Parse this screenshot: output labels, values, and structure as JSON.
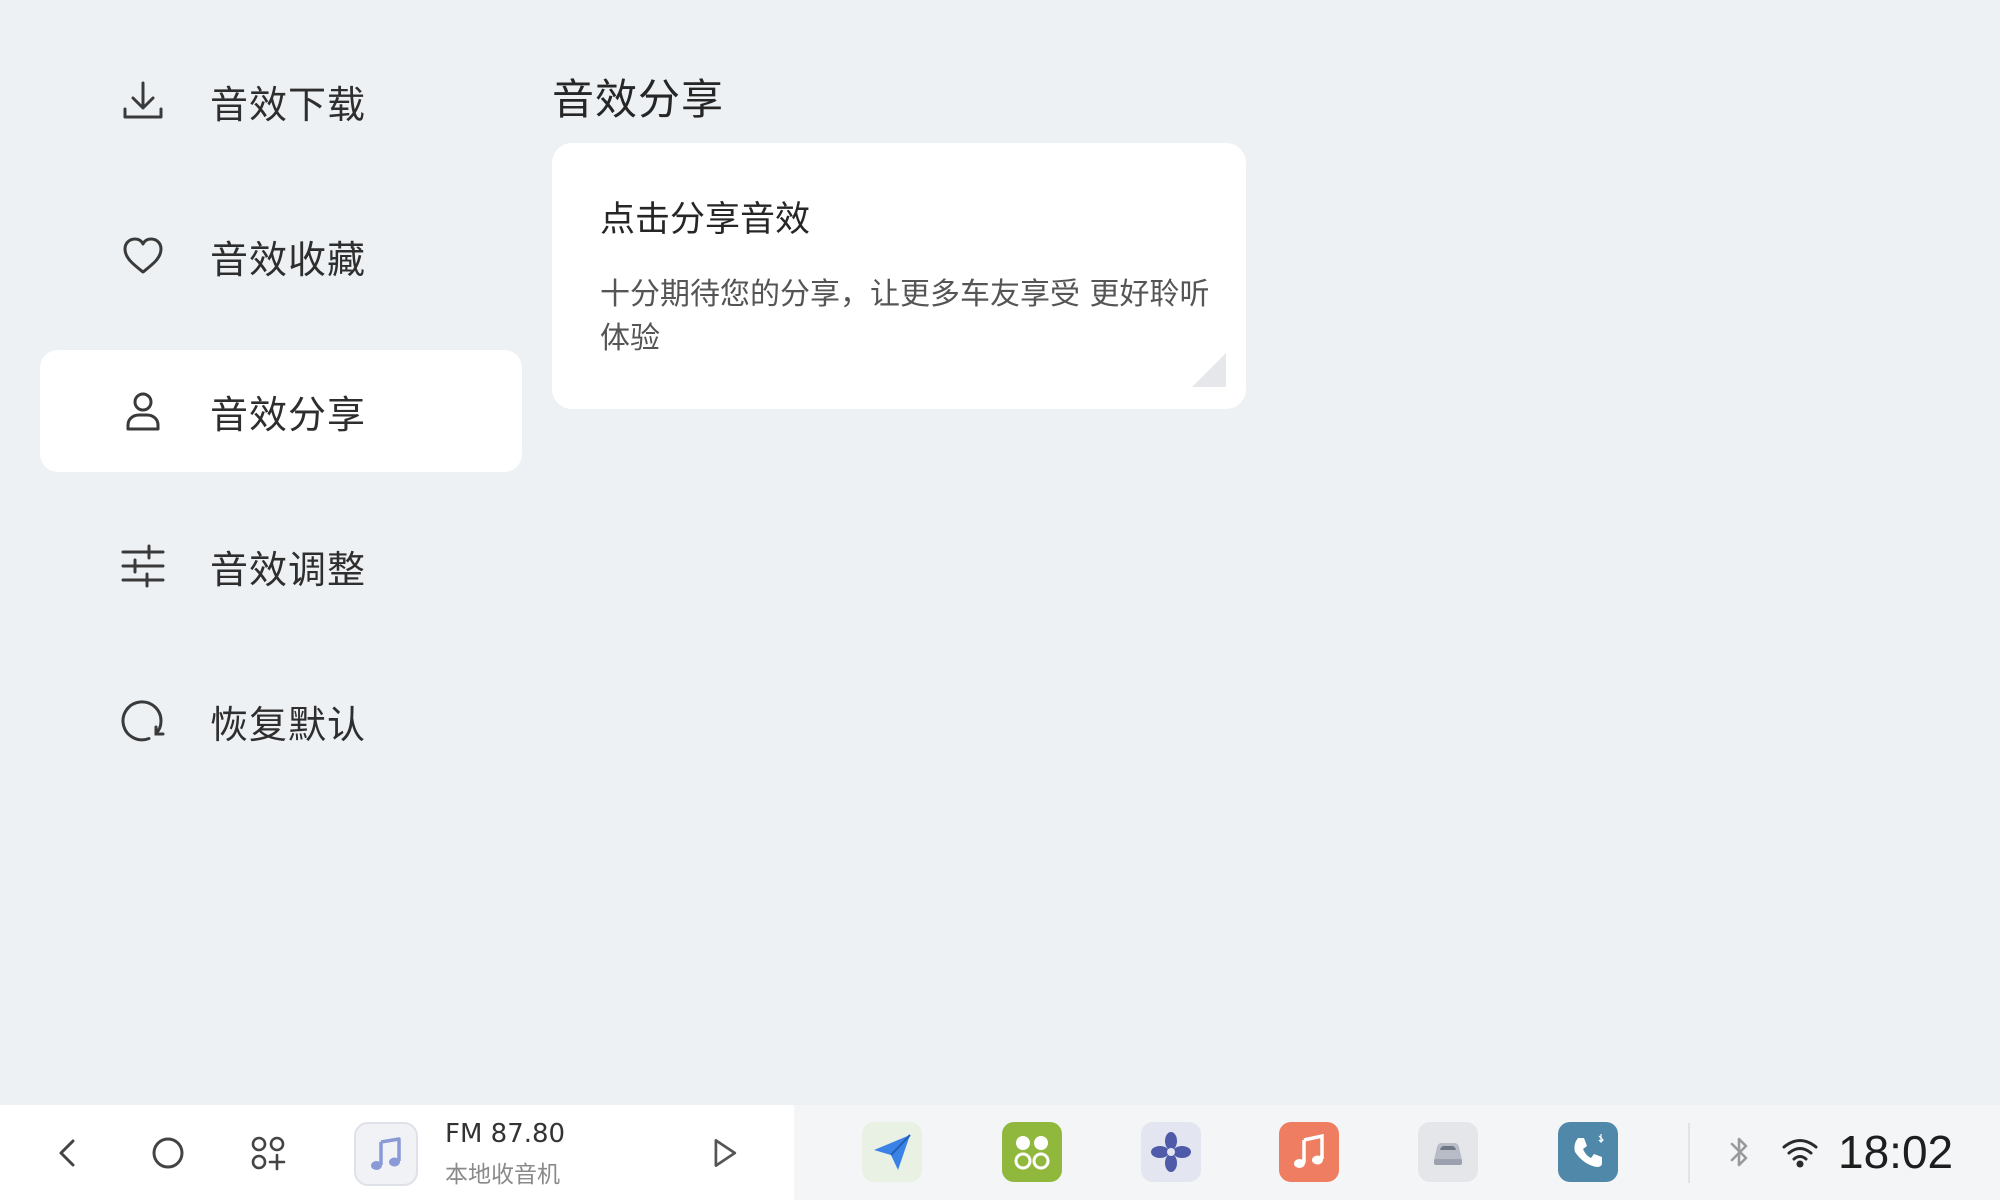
{
  "sidebar": {
    "items": [
      {
        "label": "音效下载",
        "icon": "download-icon"
      },
      {
        "label": "音效收藏",
        "icon": "heart-icon"
      },
      {
        "label": "音效分享",
        "icon": "person-icon",
        "active": true
      },
      {
        "label": "音效调整",
        "icon": "sliders-icon"
      },
      {
        "label": "恢复默认",
        "icon": "refresh-icon"
      }
    ]
  },
  "main": {
    "title": "音效分享",
    "card": {
      "title": "点击分享音效",
      "description": "十分期待您的分享，让更多车友享受 更好聆听体验"
    }
  },
  "dock": {
    "media": {
      "title": "FM 87.80",
      "subtitle": "本地收音机"
    },
    "apps": [
      {
        "name": "navigation-app",
        "icon": "paper-plane-icon",
        "color": "#3b82e6"
      },
      {
        "name": "apps-app",
        "icon": "four-dots-icon",
        "color": "#8fb83d"
      },
      {
        "name": "climate-app",
        "icon": "fan-icon",
        "color": "#4f5aa8"
      },
      {
        "name": "music-app",
        "icon": "music-note-icon",
        "color": "#ef7d62"
      },
      {
        "name": "vehicle-app",
        "icon": "car-icon",
        "color": "#c9ccd3"
      },
      {
        "name": "phone-app",
        "icon": "phone-icon",
        "color": "#4f88a8"
      }
    ],
    "time": "18:02"
  },
  "colors": {
    "background": "#eef1f4",
    "card": "#ffffff",
    "text": "#2b2b2b"
  }
}
